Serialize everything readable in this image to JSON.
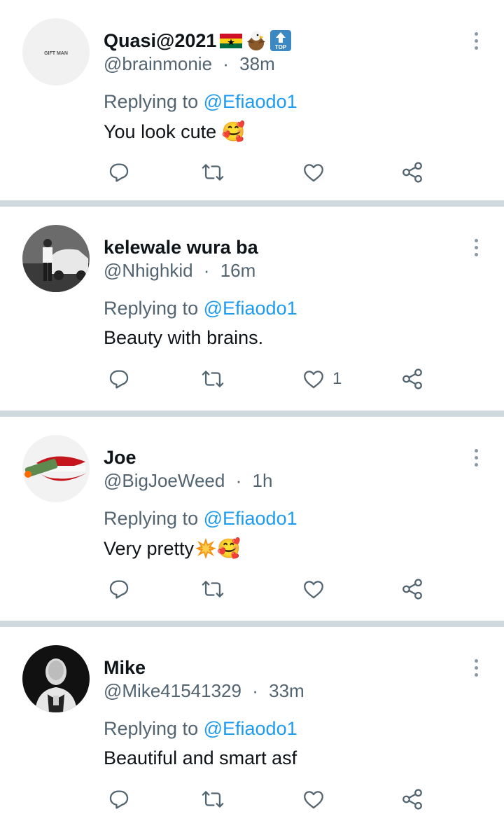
{
  "tweets": [
    {
      "name": "Quasi@2021",
      "handle": "@brainmonie",
      "sep": "·",
      "time": "38m",
      "replying_prefix": "Replying to",
      "replying_to": "@Efiaodo1",
      "text": "You look cute 🥰",
      "likes": "",
      "avatar_text": "GIFT MAN"
    },
    {
      "name": "kelewale wura ba",
      "handle": "@Nhighkid",
      "sep": "·",
      "time": "16m",
      "replying_prefix": "Replying to",
      "replying_to": "@Efiaodo1",
      "text": "Beauty with brains.",
      "likes": "1"
    },
    {
      "name": "Joe",
      "handle": "@BigJoeWeed",
      "sep": "·",
      "time": "1h",
      "replying_prefix": "Replying to",
      "replying_to": "@Efiaodo1",
      "text": "Very pretty",
      "text_suffix": "🥰",
      "likes": ""
    },
    {
      "name": "Mike",
      "handle": "@Mike41541329",
      "sep": "·",
      "time": "33m",
      "replying_prefix": "Replying to",
      "replying_to": "@Efiaodo1",
      "text": "Beautiful and smart asf",
      "likes": ""
    }
  ],
  "icons": {
    "reply": "reply-icon",
    "retweet": "retweet-icon",
    "like": "heart-icon",
    "share": "share-icon",
    "more": "more-vertical-icon"
  },
  "emoji_badges": {
    "top_label": "TOP"
  },
  "colors": {
    "text_primary": "#0f1419",
    "text_secondary": "#536471",
    "link": "#1d9bf0",
    "separator": "#cfd9de"
  }
}
